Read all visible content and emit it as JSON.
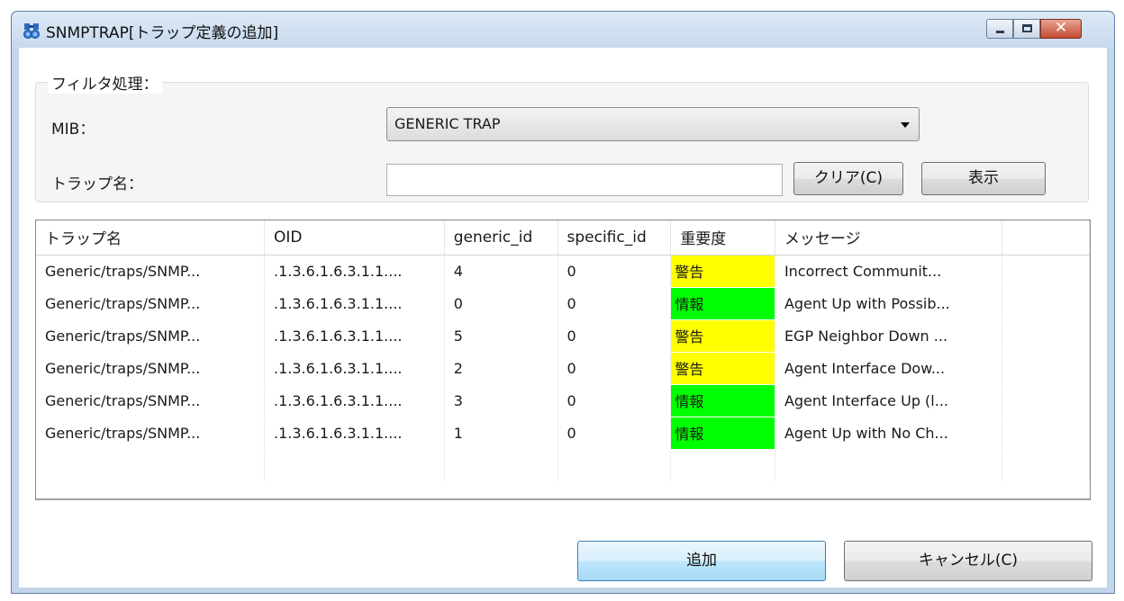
{
  "window": {
    "title": "SNMPTRAP[トラップ定義の追加]",
    "close_glyph": "✕"
  },
  "filter": {
    "group_title": "フィルタ処理：",
    "mib_label": "MIB：",
    "mib_value": "GENERIC TRAP",
    "trap_name_label": "トラップ名：",
    "trap_name_value": "",
    "clear_button": "クリア(C)",
    "show_button": "表示"
  },
  "table": {
    "columns": [
      "トラップ名",
      "OID",
      "generic_id",
      "specific_id",
      "重要度",
      "メッセージ"
    ],
    "rows": [
      {
        "name": "Generic/traps/SNMP...",
        "oid": ".1.3.6.1.6.3.1.1....",
        "generic_id": "4",
        "specific_id": "0",
        "severity": "警告",
        "severity_level": "warning",
        "message": "Incorrect Communit..."
      },
      {
        "name": "Generic/traps/SNMP...",
        "oid": ".1.3.6.1.6.3.1.1....",
        "generic_id": "0",
        "specific_id": "0",
        "severity": "情報",
        "severity_level": "info",
        "message": "Agent Up with Possib..."
      },
      {
        "name": "Generic/traps/SNMP...",
        "oid": ".1.3.6.1.6.3.1.1....",
        "generic_id": "5",
        "specific_id": "0",
        "severity": "警告",
        "severity_level": "warning",
        "message": "EGP Neighbor Down ..."
      },
      {
        "name": "Generic/traps/SNMP...",
        "oid": ".1.3.6.1.6.3.1.1....",
        "generic_id": "2",
        "specific_id": "0",
        "severity": "警告",
        "severity_level": "warning",
        "message": "Agent Interface Dow..."
      },
      {
        "name": "Generic/traps/SNMP...",
        "oid": ".1.3.6.1.6.3.1.1....",
        "generic_id": "3",
        "specific_id": "0",
        "severity": "情報",
        "severity_level": "info",
        "message": "Agent Interface Up (l..."
      },
      {
        "name": "Generic/traps/SNMP...",
        "oid": ".1.3.6.1.6.3.1.1....",
        "generic_id": "1",
        "specific_id": "0",
        "severity": "情報",
        "severity_level": "info",
        "message": "Agent Up with No Ch..."
      }
    ]
  },
  "footer": {
    "add_button": "追加",
    "cancel_button": "キャンセル(C)"
  },
  "colors": {
    "warning": "#ffff00",
    "info": "#00ff00"
  },
  "icons": {
    "app": "binoculars-icon"
  }
}
